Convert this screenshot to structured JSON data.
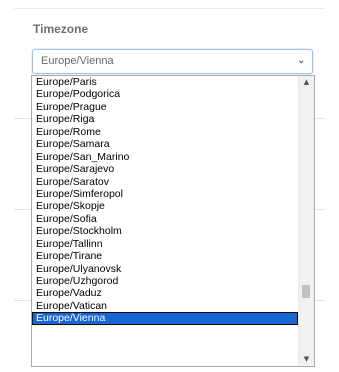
{
  "timezone_field": {
    "label": "Timezone",
    "selected_value": "Europe/Vienna"
  },
  "dropdown": {
    "options": [
      "Europe/Paris",
      "Europe/Podgorica",
      "Europe/Prague",
      "Europe/Riga",
      "Europe/Rome",
      "Europe/Samara",
      "Europe/San_Marino",
      "Europe/Sarajevo",
      "Europe/Saratov",
      "Europe/Simferopol",
      "Europe/Skopje",
      "Europe/Sofia",
      "Europe/Stockholm",
      "Europe/Tallinn",
      "Europe/Tirane",
      "Europe/Ulyanovsk",
      "Europe/Uzhgorod",
      "Europe/Vaduz",
      "Europe/Vatican",
      "Europe/Vienna"
    ],
    "selected_option": "Europe/Vienna",
    "scroll_position_fraction": 0.78
  },
  "icons": {
    "select_chevron": "chevron-down-icon",
    "scroll_up": "triangle-up-icon",
    "scroll_down": "triangle-down-icon"
  },
  "colors": {
    "selected_background": "#1766d1",
    "selected_text": "#ffffff",
    "label_text": "#6f6f6f",
    "select_border": "#9fc3ee"
  }
}
